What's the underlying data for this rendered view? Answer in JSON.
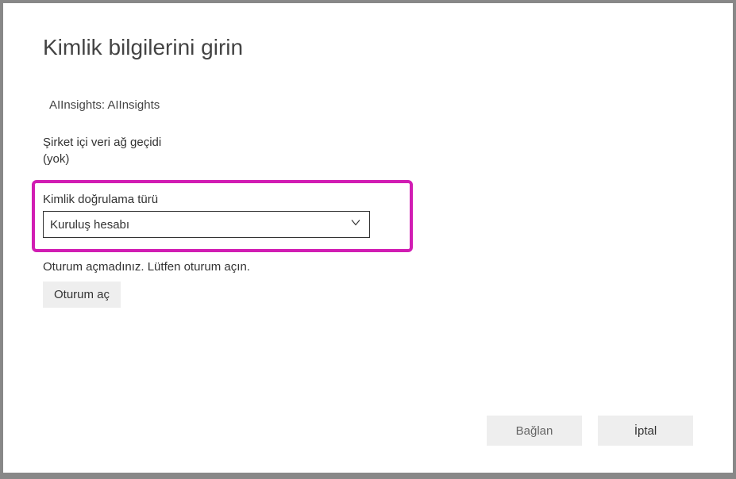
{
  "dialog": {
    "title": "Kimlik bilgilerini girin",
    "datasource_info": "AIInsights: AIInsights",
    "gateway": {
      "label": "Şirket içi veri ağ geçidi",
      "value": "(yok)"
    },
    "auth": {
      "label": "Kimlik doğrulama türü",
      "selected": "Kuruluş hesabı"
    },
    "signin": {
      "status": "Oturum açmadınız. Lütfen oturum açın.",
      "button": "Oturum aç"
    },
    "footer": {
      "connect": "Bağlan",
      "cancel": "İptal"
    }
  }
}
